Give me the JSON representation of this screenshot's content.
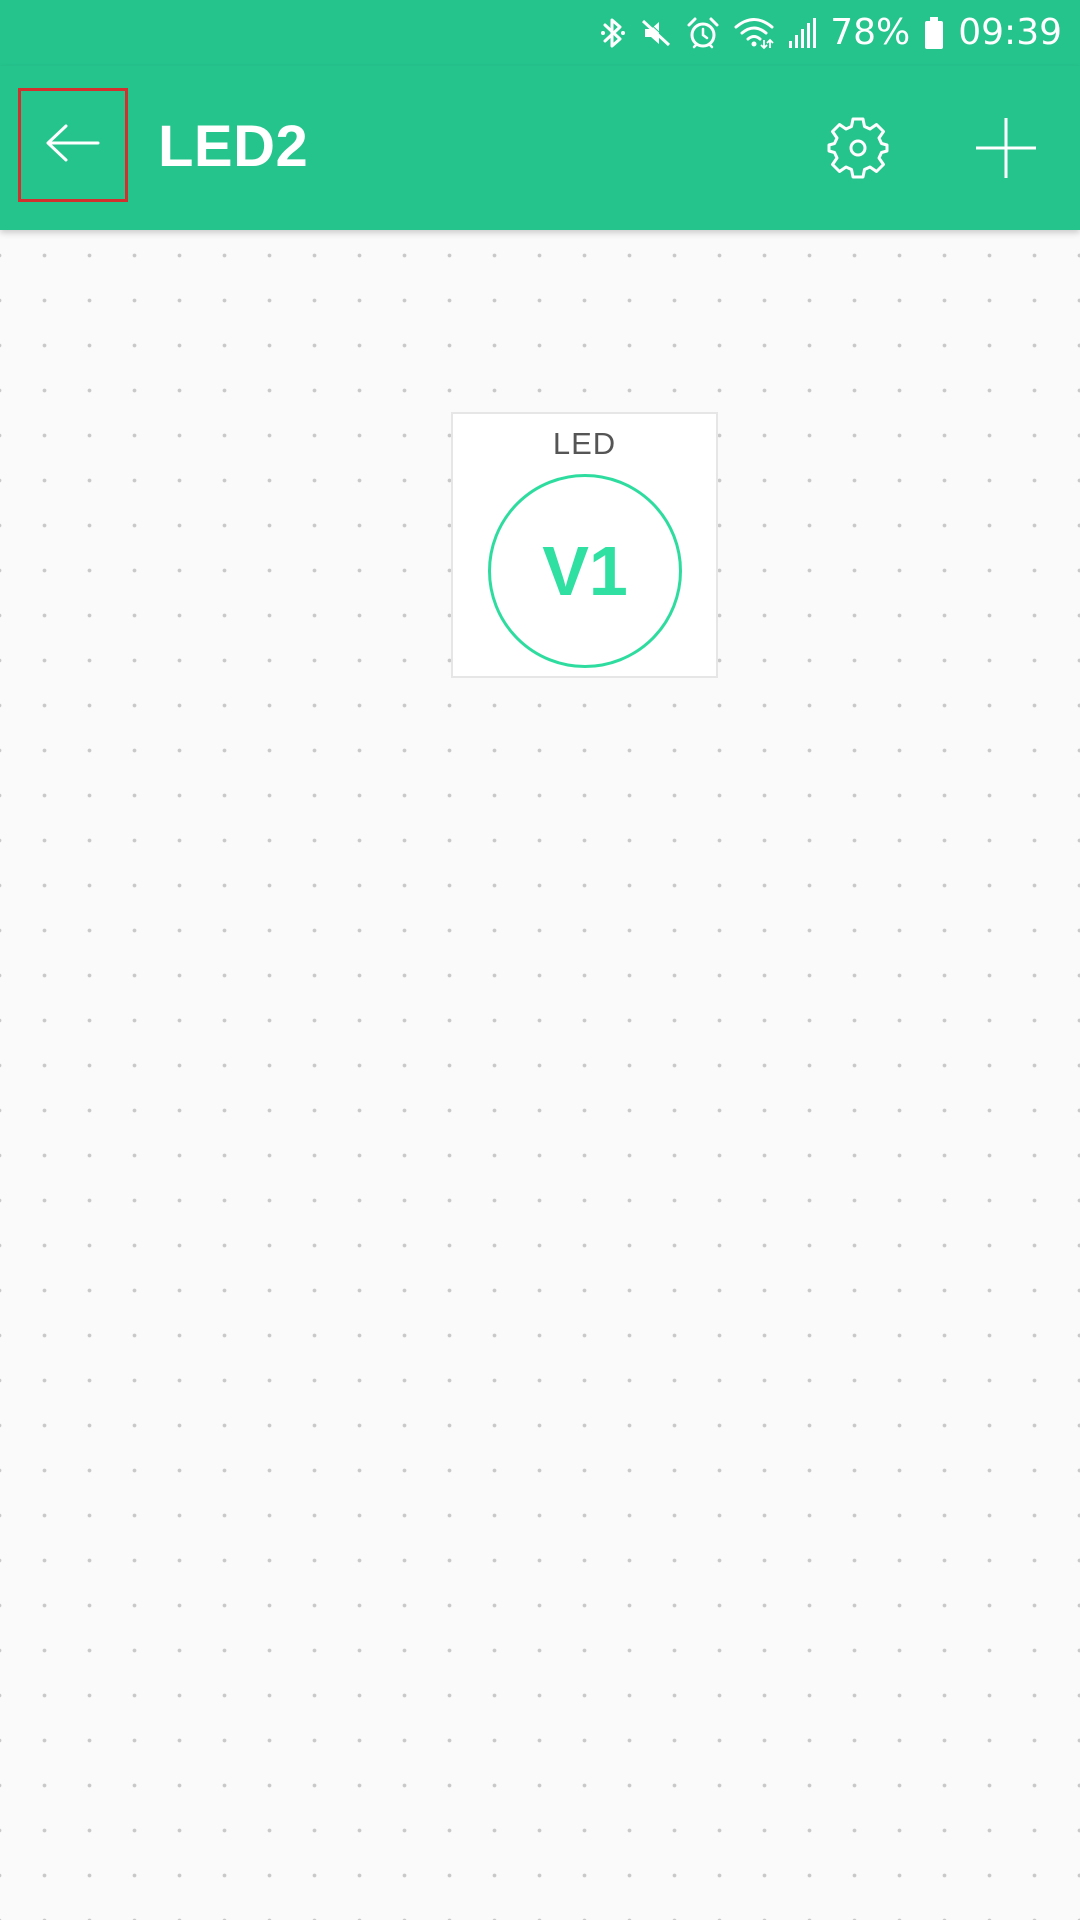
{
  "colors": {
    "accent": "#25c48d",
    "led_ring": "#2fdca0",
    "back_highlight": "#d1302f",
    "canvas": "#fafafa"
  },
  "statusbar": {
    "battery": "78%",
    "time": "09:39",
    "icons": [
      "bluetooth-icon",
      "mute-icon",
      "alarm-icon",
      "wifi-icon",
      "signal-icon",
      "battery-icon"
    ]
  },
  "appbar": {
    "title": "LED2",
    "back_icon": "arrow-left-icon",
    "settings_icon": "gear-icon",
    "add_icon": "plus-icon"
  },
  "widget": {
    "label": "LED",
    "pin": "V1"
  }
}
